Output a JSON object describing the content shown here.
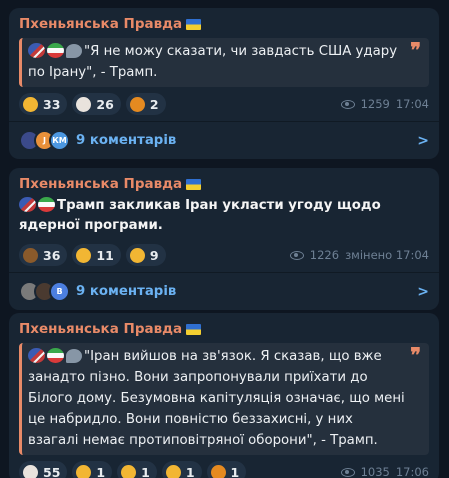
{
  "posts": [
    {
      "channel": "Пхеньянська Правда",
      "quote_text": "\"Я не можу сказати, чи завдасть США удару по Ірану\", - Трамп.",
      "reactions": [
        {
          "icon": "grinning-face-icon",
          "color": "#f2b633",
          "count": "33"
        },
        {
          "icon": "clown-face-icon",
          "color": "#e9e3dd",
          "count": "26"
        },
        {
          "icon": "pumpkin-icon",
          "color": "#e58a20",
          "count": "2"
        }
      ],
      "views": "1259",
      "time": "17:04",
      "comments_label": "9 коментарів",
      "avatars": [
        "",
        "J",
        "КМ"
      ]
    },
    {
      "channel": "Пхеньянська Правда",
      "body_text": "Трамп закликав Іран укласти угоду щодо ядерної програми.",
      "reactions": [
        {
          "icon": "poop-icon",
          "color": "#8a5a2b",
          "count": "36"
        },
        {
          "icon": "grinning-face-icon",
          "color": "#f2b633",
          "count": "11"
        },
        {
          "icon": "rofl-face-icon",
          "color": "#f2b633",
          "count": "9"
        }
      ],
      "views": "1226",
      "time": "змінено 17:04",
      "comments_label": "9 коментарів",
      "avatars": [
        "",
        "",
        "В"
      ]
    },
    {
      "channel": "Пхеньянська Правда",
      "quote_text": "\"Іран вийшов на зв'язок. Я сказав, що вже занадто пізно. Вони запропонували приїхати до Білого дому. Безумовна капітуляція означає, що мені це набридло. Вони повністю беззахисні, у них взагалі немає протиповітряної оборони\", - Трамп.",
      "reactions": [
        {
          "icon": "clown-face-icon",
          "color": "#e9e3dd",
          "count": "55"
        },
        {
          "icon": "thumbs-up-icon",
          "color": "#f2b633",
          "count": "1"
        },
        {
          "icon": "hearts-face-icon",
          "color": "#f2b633",
          "count": "1"
        },
        {
          "icon": "grinning-face-icon",
          "color": "#f2b633",
          "count": "1"
        },
        {
          "icon": "pumpkin-icon",
          "color": "#e58a20",
          "count": "1"
        }
      ],
      "views": "1035",
      "time": "17:06"
    }
  ],
  "colors": {
    "background": "#0e1621",
    "bubble": "#182533",
    "accent": "#e88a68",
    "link": "#6bb2f2"
  }
}
